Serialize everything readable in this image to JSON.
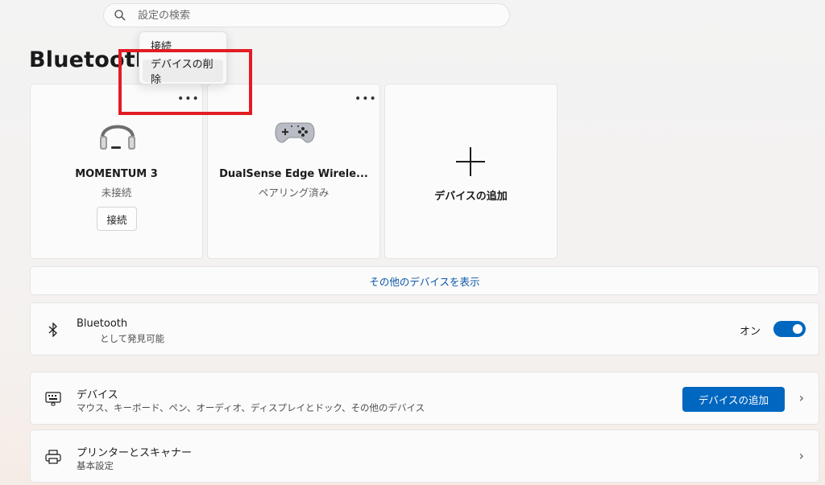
{
  "search": {
    "placeholder": "設定の検索"
  },
  "page_title": "Bluetooth の",
  "context_menu": {
    "items": [
      "接続",
      "デバイスの削除"
    ]
  },
  "devices": [
    {
      "name": "MOMENTUM 3",
      "status": "未接続",
      "action": "接続",
      "icon": "headphones-icon"
    },
    {
      "name": "DualSense Edge Wirele...",
      "status": "ペアリング済み",
      "icon": "gamepad-icon"
    }
  ],
  "add_device_card": {
    "label": "デバイスの追加",
    "icon": "plus-icon"
  },
  "more_devices_link": "その他のデバイスを表示",
  "bluetooth_row": {
    "title": "Bluetooth",
    "subtitle": "として発見可能",
    "toggle_label": "オン",
    "toggle_state": true,
    "icon": "bluetooth-icon"
  },
  "devices_row": {
    "title": "デバイス",
    "subtitle": "マウス、キーボード、ペン、オーディオ、ディスプレイとドック、その他のデバイス",
    "button_label": "デバイスの追加",
    "icon": "keyboard-icon"
  },
  "printers_row": {
    "title": "プリンターとスキャナー",
    "subtitle": "基本設定",
    "icon": "printer-icon"
  },
  "colors": {
    "accent": "#0067c0",
    "highlight_box": "#e31c23",
    "link": "#0b57a8"
  }
}
